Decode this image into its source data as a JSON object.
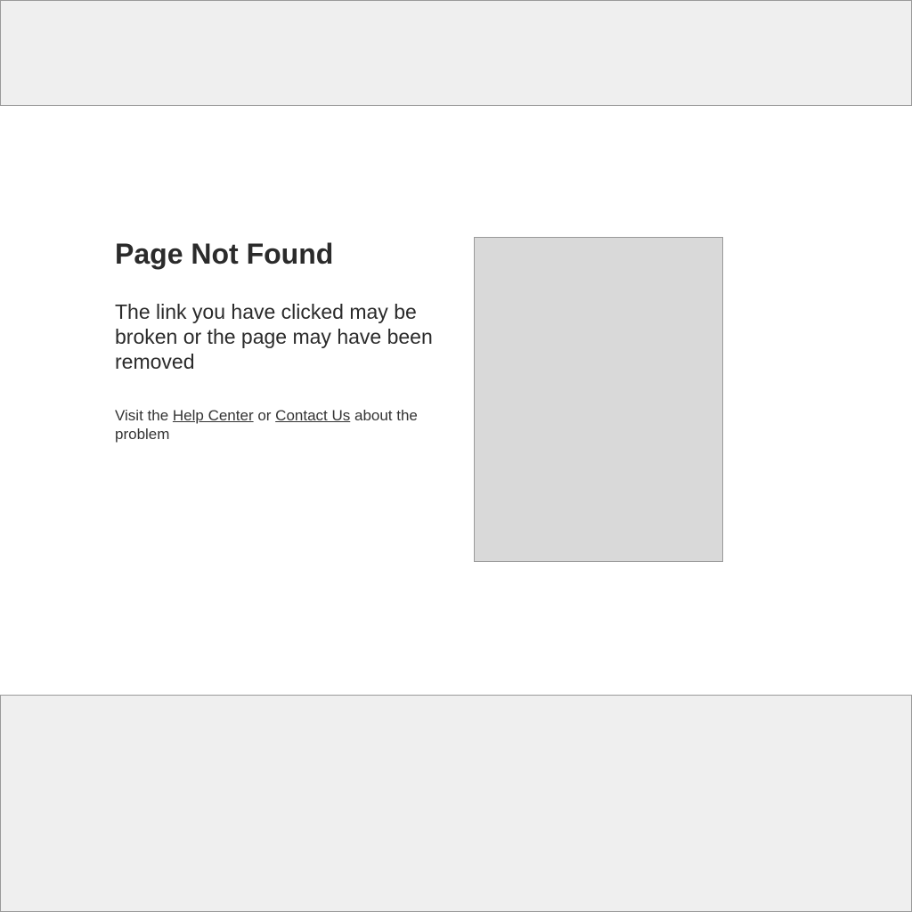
{
  "error": {
    "title": "Page Not Found",
    "message": "The link you have clicked may be broken or the page may have been removed",
    "help_prefix": "Visit the ",
    "help_center_link": "Help Center",
    "help_middle": " or ",
    "contact_link": "Contact Us",
    "help_suffix": " about the problem"
  },
  "colors": {
    "placeholder_fill": "#efefef",
    "image_fill": "#d9d9d9",
    "border": "#9a9a9a",
    "text": "#2b2b2b"
  }
}
